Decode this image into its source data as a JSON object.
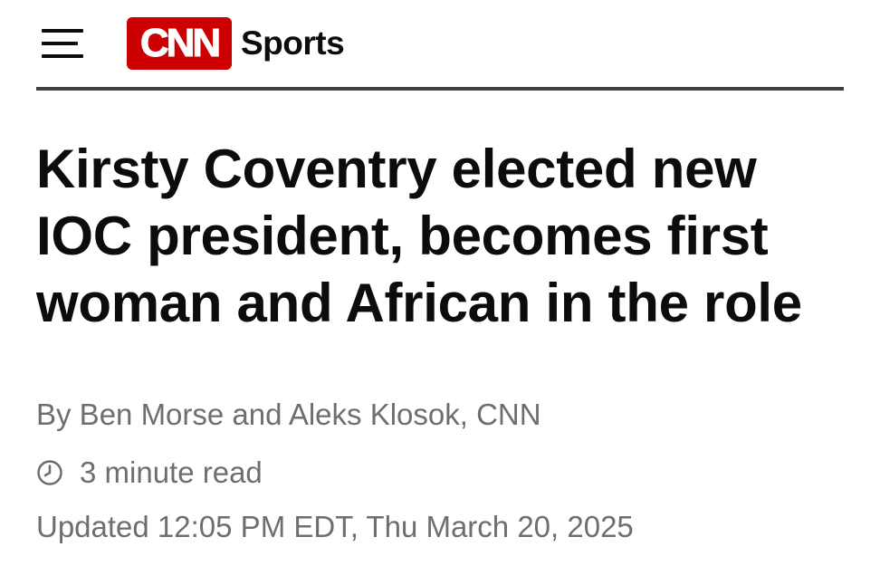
{
  "header": {
    "logo_text": "CNN",
    "section": "Sports",
    "brand_color": "#cc0000"
  },
  "article": {
    "headline": "Kirsty Coventry elected new IOC president, becomes first woman and African in the role",
    "byline": "By Ben Morse and Aleks Klosok, CNN",
    "read_time": "3 minute read",
    "updated": "Updated 12:05 PM EDT, Thu March 20, 2025"
  },
  "icons": {
    "menu": "hamburger-menu-icon",
    "clock": "clock-icon"
  }
}
